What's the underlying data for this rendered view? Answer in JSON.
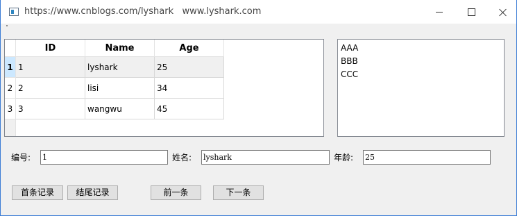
{
  "window": {
    "title": "https://www.cnblogs.com/lyshark   www.lyshark.com"
  },
  "table": {
    "columns": [
      "ID",
      "Name",
      "Age"
    ],
    "row_headers": [
      "1",
      "2",
      "3"
    ],
    "rows": [
      [
        "1",
        "lyshark",
        "25"
      ],
      [
        "2",
        "lisi",
        "34"
      ],
      [
        "3",
        "wangwu",
        "45"
      ]
    ]
  },
  "list": {
    "items": [
      "AAA",
      "BBB",
      "CCC"
    ]
  },
  "form": {
    "id_label": "编号:",
    "id_value": "1",
    "name_label": "姓名:",
    "name_value": "lyshark",
    "age_label": "年龄:",
    "age_value": "25"
  },
  "buttons": {
    "first": "首条记录",
    "last": "结尾记录",
    "prev": "前一条",
    "next": "下一条"
  }
}
